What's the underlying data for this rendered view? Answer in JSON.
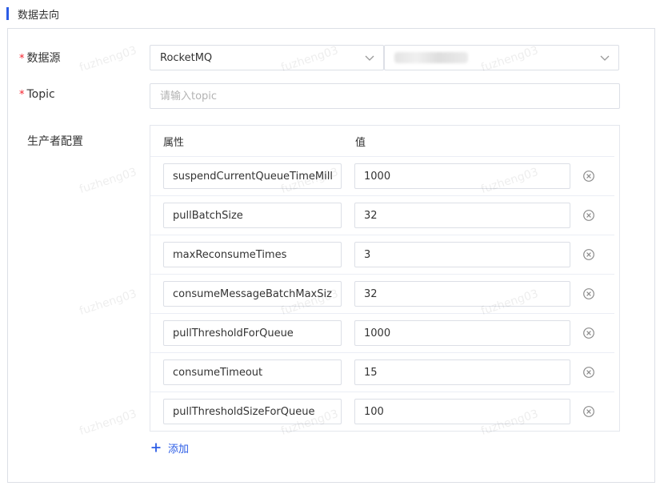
{
  "section": {
    "title": "数据去向"
  },
  "form": {
    "datasource": {
      "label": "数据源",
      "required_mark": "*",
      "type_value": "RocketMQ"
    },
    "topic": {
      "label": "Topic",
      "required_mark": "*",
      "placeholder": "请输入topic",
      "value": ""
    },
    "producer_config": {
      "label": "生产者配置",
      "headers": {
        "key": "属性",
        "value": "值"
      },
      "rows": [
        {
          "key": "suspendCurrentQueueTimeMillis",
          "value": "1000"
        },
        {
          "key": "pullBatchSize",
          "value": "32"
        },
        {
          "key": "maxReconsumeTimes",
          "value": "3"
        },
        {
          "key": "consumeMessageBatchMaxSize",
          "value": "32"
        },
        {
          "key": "pullThresholdForQueue",
          "value": "1000"
        },
        {
          "key": "consumeTimeout",
          "value": "15"
        },
        {
          "key": "pullThresholdSizeForQueue",
          "value": "100"
        }
      ],
      "add_label": "添加"
    }
  },
  "watermark": {
    "text": "fuzheng03"
  },
  "colors": {
    "accent": "#2b5ce6",
    "required": "#f5222d",
    "border": "#dcdfe6"
  },
  "icons": {
    "select_arrow": "chevron-down-icon",
    "remove": "circle-close-icon",
    "add": "plus-icon"
  }
}
